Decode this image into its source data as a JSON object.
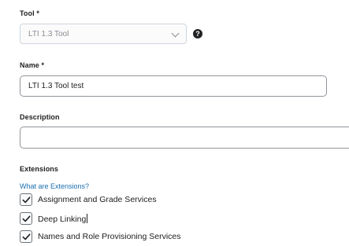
{
  "tool": {
    "label": "Tool",
    "required_mark": "*",
    "selected": "LTI 1.3 Tool",
    "help_glyph": "?"
  },
  "name": {
    "label": "Name",
    "required_mark": "*",
    "value": "LTI 1.3 Tool test"
  },
  "description": {
    "label": "Description",
    "value": ""
  },
  "extensions": {
    "heading": "Extensions",
    "link": "What are Extensions?",
    "options": [
      {
        "label": "Assignment and Grade Services",
        "checked": true
      },
      {
        "label": "Deep Linking",
        "checked": true
      },
      {
        "label": "Names and Role Provisioning Services",
        "checked": true
      }
    ]
  },
  "colors": {
    "link": "#1a6fb0",
    "text": "#202122",
    "placeholder_text": "#8a8c8f"
  }
}
